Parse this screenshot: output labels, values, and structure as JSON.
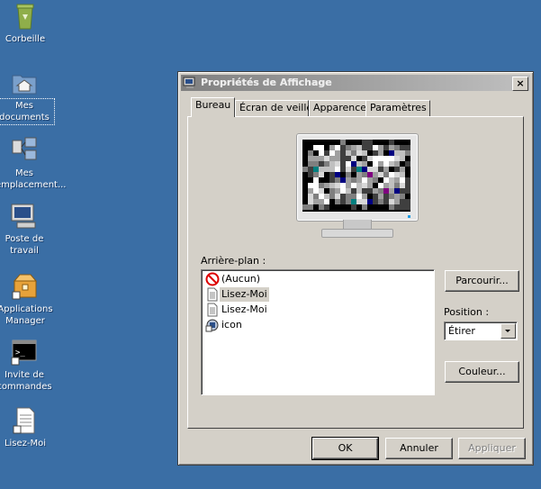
{
  "desktop": {
    "icons": [
      {
        "label": "Corbeille",
        "icon": "recycle-bin-icon"
      },
      {
        "label": "Mes documents",
        "icon": "my-documents-icon"
      },
      {
        "label": "Mes emplacement...",
        "icon": "network-places-icon"
      },
      {
        "label": "Poste de travail",
        "icon": "my-computer-icon"
      },
      {
        "label": "Applications Manager",
        "icon": "applications-manager-icon"
      },
      {
        "label": "Invite de commandes",
        "icon": "command-prompt-icon"
      },
      {
        "label": "Lisez-Moi",
        "icon": "text-file-icon"
      }
    ]
  },
  "dialog": {
    "title": "Propriétés de Affichage",
    "close_label": "×",
    "tabs": [
      {
        "label": "Bureau",
        "active": true
      },
      {
        "label": "Écran de veille"
      },
      {
        "label": "Apparence"
      },
      {
        "label": "Paramètres"
      }
    ],
    "background_label": "Arrière-plan :",
    "backgrounds": [
      {
        "label": "(Aucun)",
        "icon": "none-icon"
      },
      {
        "label": "Lisez-Moi",
        "icon": "text-file-icon",
        "selected": true
      },
      {
        "label": "Lisez-Moi",
        "icon": "text-file-icon"
      },
      {
        "label": "icon",
        "icon": "image-file-icon"
      }
    ],
    "browse_label": "Parcourir...",
    "position_label": "Position :",
    "position_value": "Étirer",
    "color_label": "Couleur...",
    "ok_label": "OK",
    "cancel_label": "Annuler",
    "apply_label": "Appliquer"
  },
  "colors": {
    "desktop": "#3a6ea5",
    "dialog_face": "#d4d0c8"
  }
}
